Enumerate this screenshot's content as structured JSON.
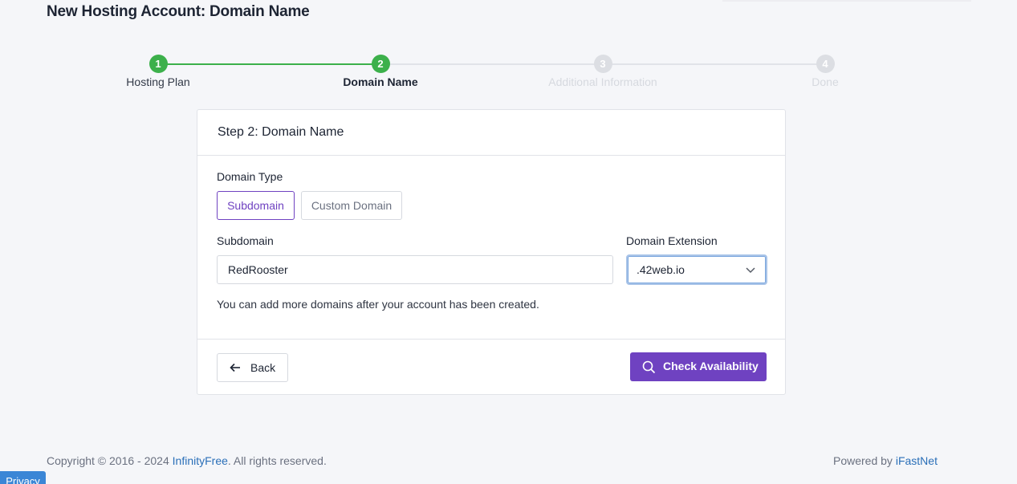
{
  "page": {
    "title": "New Hosting Account: Domain Name"
  },
  "stepper": {
    "steps": [
      {
        "number": "1",
        "label": "Hosting Plan",
        "state": "done"
      },
      {
        "number": "2",
        "label": "Domain Name",
        "state": "active"
      },
      {
        "number": "3",
        "label": "Additional Information",
        "state": "todo"
      },
      {
        "number": "4",
        "label": "Done",
        "state": "todo"
      }
    ]
  },
  "card": {
    "header": "Step 2: Domain Name",
    "domain_type": {
      "label": "Domain Type",
      "options": [
        "Subdomain",
        "Custom Domain"
      ],
      "selected": "Subdomain"
    },
    "subdomain": {
      "label": "Subdomain",
      "value": "RedRooster"
    },
    "extension": {
      "label": "Domain Extension",
      "selected": ".42web.io"
    },
    "help_text": "You can add more domains after your account has been created.",
    "back_label": "Back",
    "check_label": "Check Availability"
  },
  "footer": {
    "copyright_prefix": "Copyright © 2016 - 2024 ",
    "copyright_link": "InfinityFree",
    "copyright_suffix": ". All rights reserved.",
    "powered_prefix": "Powered by ",
    "powered_link": "iFastNet",
    "privacy_label": "Privacy"
  },
  "colors": {
    "accent": "#6f42c1",
    "success": "#3cb04b",
    "link": "#2a6fb8"
  }
}
